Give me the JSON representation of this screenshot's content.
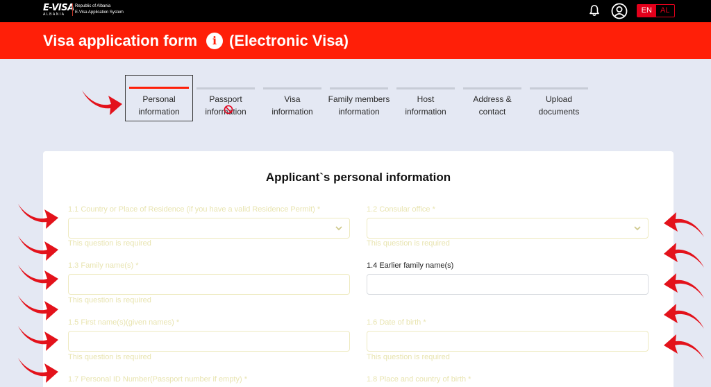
{
  "topbar": {
    "logo_main": "E-VISA",
    "logo_sub": "ALBANIA",
    "logo_line1": "Republic of Albania",
    "logo_line2": "E-Visa Application System",
    "lang_en": "EN",
    "lang_al": "AL"
  },
  "header": {
    "title": "Visa application form",
    "info_glyph": "i",
    "subtitle": "(Electronic Visa)"
  },
  "steps": [
    {
      "label": "Personal information"
    },
    {
      "label": "Passport information"
    },
    {
      "label": "Visa information"
    },
    {
      "label": "Family members information"
    },
    {
      "label": "Host information"
    },
    {
      "label": "Address & contact"
    },
    {
      "label": "Upload documents"
    }
  ],
  "form": {
    "title": "Applicant`s personal information",
    "required_msg": "This question is required",
    "fields": [
      {
        "label": "1.1 Country or Place of Residence (if you have a valid Residence Permit) *",
        "type": "select",
        "value": ""
      },
      {
        "label": "1.2 Consular office *",
        "type": "select",
        "value": ""
      },
      {
        "label": "1.3 Family name(s) *",
        "type": "text",
        "value": ""
      },
      {
        "label": "1.4 Earlier family name(s)",
        "type": "text",
        "value": ""
      },
      {
        "label": "1.5 First name(s)(given names) *",
        "type": "text",
        "value": ""
      },
      {
        "label": "1.6 Date of birth *",
        "type": "text",
        "value": ""
      },
      {
        "label": "1.7 Personal ID Number(Passport number if empty) *",
        "type": "text",
        "value": ""
      },
      {
        "label": "1.8 Place and country of birth *",
        "type": "text",
        "value": ""
      }
    ]
  },
  "icons": {
    "bell": "bell-icon",
    "user": "user-circle-icon",
    "info": "info-icon",
    "chevron": "chevron-down-icon",
    "arrow": "red-curved-arrow-icon"
  },
  "colors": {
    "brand_red": "#ff1f08",
    "topbar": "#000000",
    "page_bg": "#e4e8f3",
    "required_yellow": "#e8e4b0"
  }
}
